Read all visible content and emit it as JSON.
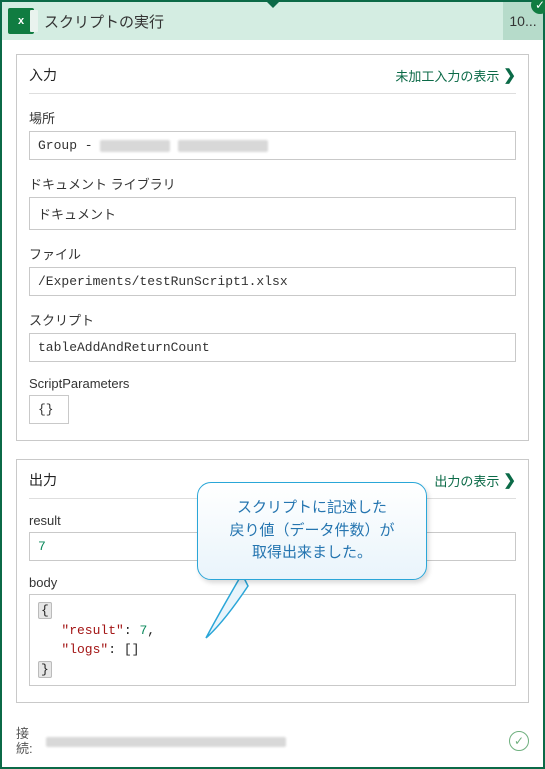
{
  "header": {
    "icon_text": "x",
    "title": "スクリプトの実行",
    "badge": "10..."
  },
  "input_section": {
    "title": "入力",
    "raw_link": "未加工入力の表示",
    "location": {
      "label": "場所",
      "value_prefix": "Group - "
    },
    "library": {
      "label": "ドキュメント ライブラリ",
      "value": "ドキュメント"
    },
    "file": {
      "label": "ファイル",
      "value": "/Experiments/testRunScript1.xlsx"
    },
    "script": {
      "label": "スクリプト",
      "value": "tableAddAndReturnCount"
    },
    "params": {
      "label": "ScriptParameters",
      "value": "{}"
    }
  },
  "output_section": {
    "title": "出力",
    "raw_link": "出力の表示",
    "result": {
      "label": "result",
      "value": "7"
    },
    "body": {
      "label": "body",
      "key_result": "\"result\"",
      "val_result": "7",
      "key_logs": "\"logs\"",
      "val_logs": "[]"
    }
  },
  "callout": {
    "line1": "スクリプトに記述した",
    "line2": "戻り値（データ件数）が",
    "line3": "取得出来ました。"
  },
  "footer": {
    "label": "接\n続:"
  }
}
